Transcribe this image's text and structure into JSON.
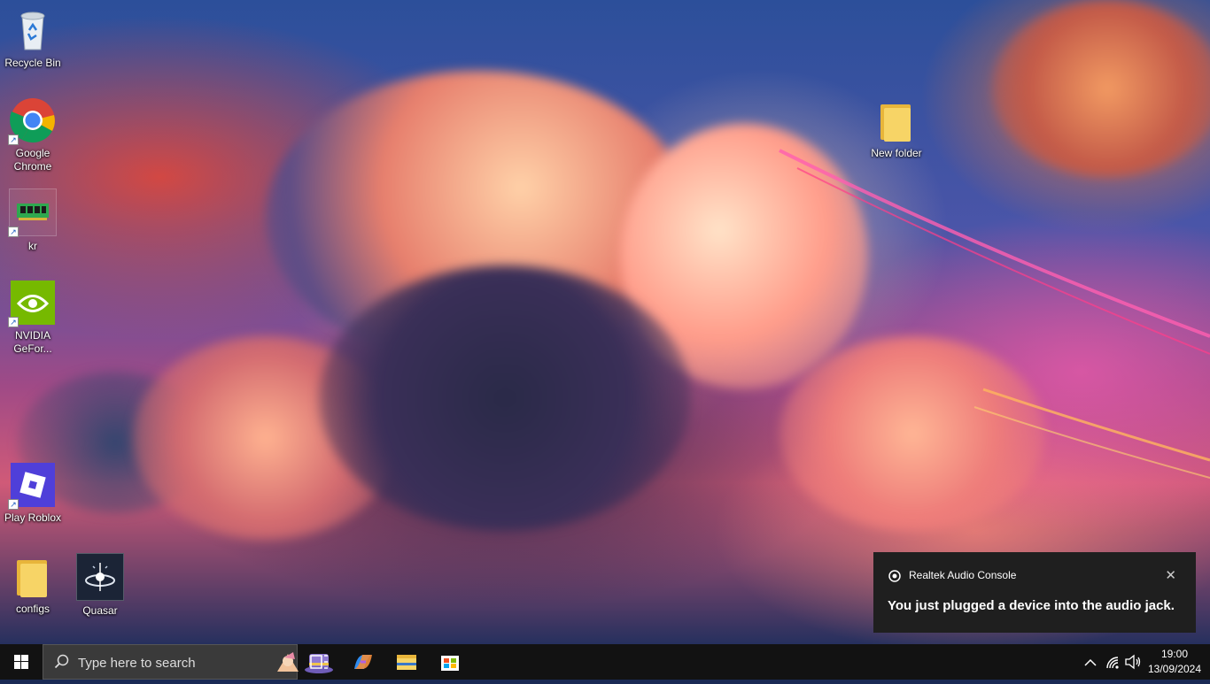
{
  "desktop": {
    "icons": [
      {
        "label": "Recycle Bin",
        "icon": "recycle-bin-icon"
      },
      {
        "label": "Google Chrome",
        "icon": "chrome-icon"
      },
      {
        "label": "kr",
        "icon": "memory-chip-icon"
      },
      {
        "label": "NVIDIA GeFor...",
        "icon": "nvidia-icon"
      },
      {
        "label": "Play Roblox",
        "icon": "roblox-icon"
      },
      {
        "label": "configs",
        "icon": "folder-icon"
      },
      {
        "label": "Quasar",
        "icon": "quasar-icon"
      },
      {
        "label": "New folder",
        "icon": "folder-icon"
      }
    ]
  },
  "notification": {
    "app_name": "Realtek Audio Console",
    "message": "You just plugged a device into the audio jack.",
    "close_symbol": "✕"
  },
  "taskbar": {
    "search_placeholder": "Type here to search",
    "apps": [
      "task-view-icon",
      "copilot-icon",
      "file-explorer-icon",
      "microsoft-store-icon"
    ],
    "tray": {
      "chevron": "^",
      "time": "19:00",
      "date": "13/09/2024"
    }
  },
  "colors": {
    "taskbar": "#121212",
    "search_box": "#3a3a3a",
    "toast": "#1f1f1f",
    "accent_blue": "#0078d4"
  }
}
